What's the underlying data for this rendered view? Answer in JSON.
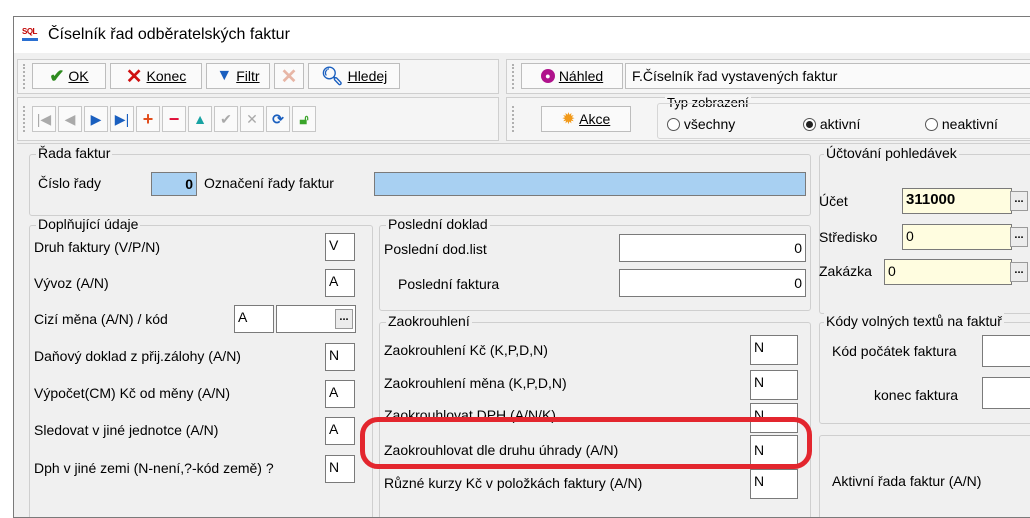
{
  "window": {
    "title": "Číselník řad odběratelských faktur",
    "app_icon": "SQL"
  },
  "toolbar": {
    "ok": "OK",
    "konec": "Konec",
    "filtr": "Filtr",
    "hledej": "Hledej",
    "nahled": "Náhled",
    "report_name": "F.Číselník řad vystavených faktur",
    "akce": "Akce",
    "typ_zobrazeni": {
      "label": "Typ zobrazení",
      "options": [
        "všechny",
        "aktivní",
        "neaktivní"
      ],
      "selected": "aktivní"
    }
  },
  "rada_faktur": {
    "legend": "Řada faktur",
    "cislo_rady_label": "Číslo řady",
    "cislo_rady_value": "0",
    "oznaceni_label": "Označení řady faktur",
    "oznaceni_value": ""
  },
  "doplnujici": {
    "legend": "Doplňující údaje",
    "druh_label": "Druh faktury (V/P/N)",
    "druh_value": "V",
    "vyvoz_label": "Vývoz (A/N)",
    "vyvoz_value": "A",
    "cizi_mena_label": "Cizí měna (A/N) / kód",
    "cizi_mena_value": "A",
    "cizi_mena_kod": "",
    "danovy_label": "Daňový doklad z přij.zálohy (A/N)",
    "danovy_value": "N",
    "vypocet_label": "Výpočet(CM) Kč od měny (A/N)",
    "vypocet_value": "A",
    "sledovat_label": "Sledovat v jiné jednotce (A/N)",
    "sledovat_value": "A",
    "dph_label": "Dph v jiné zemi (N-není,?-kód země) ?",
    "dph_value": "N"
  },
  "posledni": {
    "legend": "Poslední doklad",
    "dodlist_label": "Poslední dod.list",
    "dodlist_value": "0",
    "faktura_label": "Poslední faktura",
    "faktura_value": "0"
  },
  "zaokrouhleni": {
    "legend": "Zaokrouhlení",
    "kc_label": "Zaokrouhlení Kč (K,P,D,N)",
    "kc_value": "N",
    "mena_label": "Zaokrouhlení měna (K,P,D,N)",
    "mena_value": "N",
    "dph_label": "Zaokrouhlovat DPH (A/N/K)",
    "dph_value": "N",
    "dle_uhrady_label": "Zaokrouhlovat dle druhu úhrady (A/N)",
    "dle_uhrady_value": "N",
    "kurzy_label": "Různé kurzy Kč v položkách faktury (A/N)",
    "kurzy_value": "N"
  },
  "uctovani": {
    "legend": "Účtování pohledávek",
    "ucet_label": "Účet",
    "ucet_value": "311000",
    "stredisko_label": "Středisko",
    "stredisko_value": "0",
    "zakazka_label": "Zakázka",
    "zakazka_value": "0"
  },
  "kody": {
    "legend": "Kódy volných textů na faktuř",
    "pocatek_label": "Kód počátek faktura",
    "pocatek_value": "",
    "konec_label": "konec faktura",
    "konec_value": ""
  },
  "aktivni_rada_label": "Aktivní řada faktur (A/N)",
  "colors": {
    "highlight": "#e3262e",
    "blue_field": "#a8d0f2",
    "yellow_field": "#fffde0"
  }
}
